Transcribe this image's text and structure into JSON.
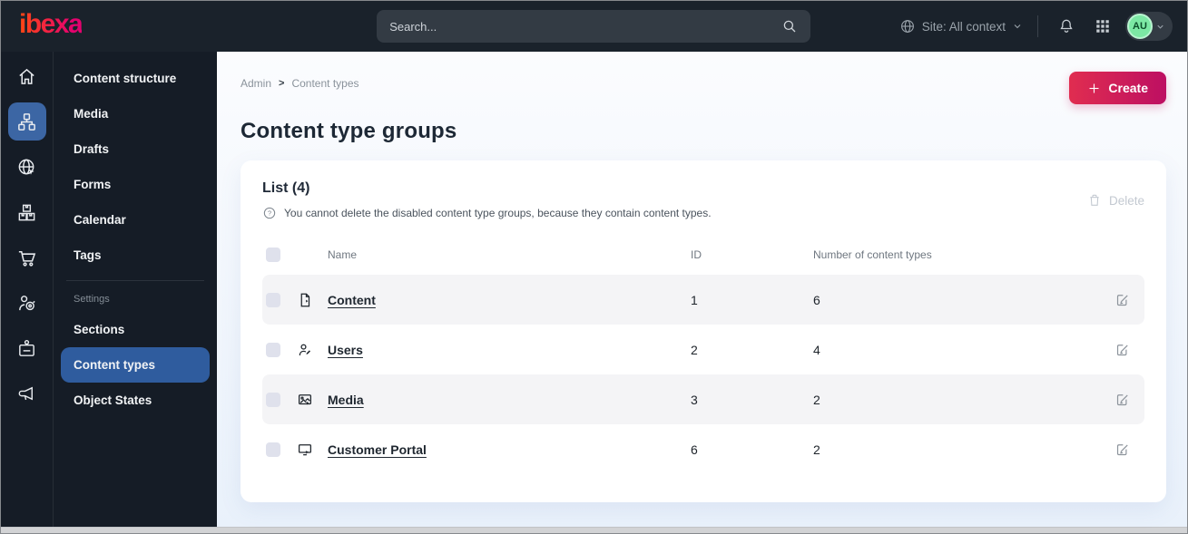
{
  "topbar": {
    "logo": "ibexa",
    "search_placeholder": "Search...",
    "site_context": "Site: All context",
    "avatar": "AU",
    "icons": [
      "search-icon",
      "globe-icon",
      "chevron-down-icon",
      "bell-icon",
      "app-grid-icon",
      "avatar-chevron-icon"
    ]
  },
  "rail": {
    "icons": [
      "home-icon",
      "content-structure-icon",
      "site-icon",
      "product-catalog-icon",
      "commerce-cart-icon",
      "personalization-icon",
      "admin-badge-icon",
      "promotions-megaphone-icon"
    ],
    "active_index": 1
  },
  "sidebar": {
    "items": [
      "Content structure",
      "Media",
      "Drafts",
      "Forms",
      "Calendar",
      "Tags"
    ],
    "section_label": "Settings",
    "settings_items": [
      "Sections",
      "Content types",
      "Object States"
    ],
    "active_item": "Content types"
  },
  "breadcrumb": {
    "items": [
      "Admin",
      "Content types"
    ],
    "separator": ">"
  },
  "page": {
    "title": "Content type groups",
    "create_label": "Create"
  },
  "list": {
    "title": "List (4)",
    "hint": "You cannot delete the disabled content type groups, because they contain content types.",
    "delete_label": "Delete",
    "columns": [
      "Name",
      "ID",
      "Number of content types"
    ],
    "rows": [
      {
        "name": "Content",
        "id": "1",
        "count": "6",
        "icon": "file-icon"
      },
      {
        "name": "Users",
        "id": "2",
        "count": "4",
        "icon": "user-icon"
      },
      {
        "name": "Media",
        "id": "3",
        "count": "2",
        "icon": "image-icon"
      },
      {
        "name": "Customer Portal",
        "id": "6",
        "count": "2",
        "icon": "monitor-icon"
      }
    ]
  },
  "colors": {
    "topbar_bg": "#1a222b",
    "sidebar_bg": "#151c26",
    "active_blue": "#2f5c9e",
    "brand_gradient_start": "#ff4713",
    "brand_gradient_end": "#e4026e",
    "create_gradient_start": "#e02d50",
    "create_gradient_end": "#bd0f62",
    "row_alt_bg": "#f4f4f6",
    "avatar_green": "#7ce8a4"
  }
}
